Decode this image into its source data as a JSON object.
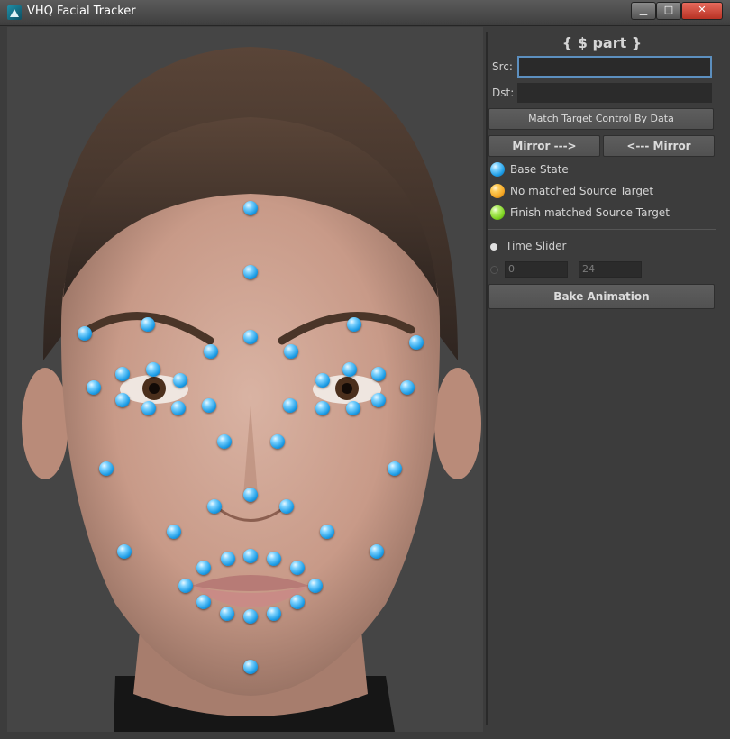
{
  "window": {
    "title": "VHQ Facial Tracker",
    "minimize": "▁",
    "maximize": "□",
    "close": "✕"
  },
  "panel": {
    "part_title": "{ $ part }",
    "src_label": "Src:",
    "src_value": "",
    "dst_label": "Dst:",
    "dst_value": "",
    "match_button": "Match Target Control By Data",
    "mirror_right_button": "Mirror --->",
    "mirror_left_button": "<--- Mirror",
    "legend": [
      {
        "label": "Base State",
        "color": "#2ba7ea"
      },
      {
        "label": "No matched Source Target",
        "color": "#f5a623"
      },
      {
        "label": "Finish matched Source Target",
        "color": "#7ed321"
      }
    ],
    "time_slider_label": "Time Slider",
    "range_start": "0",
    "range_dash": "-",
    "range_end": "24",
    "bake_button": "Bake Animation"
  },
  "colors": {
    "landmark": "#2ba7ea",
    "focus_border": "#5c8fbf",
    "panel_bg": "#3c3c3c"
  }
}
